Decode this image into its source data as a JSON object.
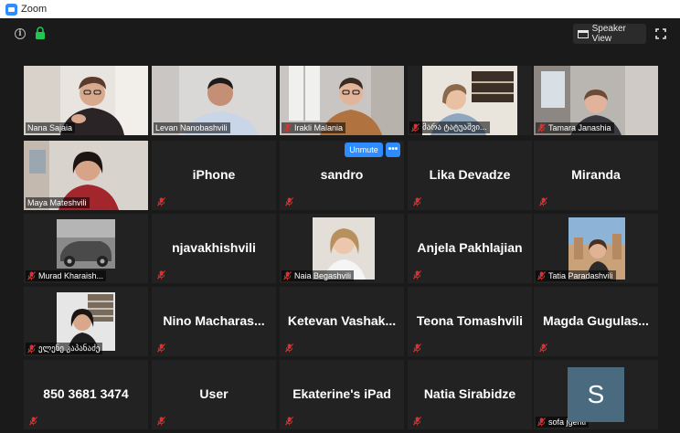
{
  "window": {
    "title": "Zoom"
  },
  "toolbar": {
    "speaker_view_label": "Speaker View"
  },
  "tile_actions": {
    "unmute_label": "Unmute",
    "more_label": "•••"
  },
  "colors": {
    "active_speaker_border": "#c6d94a",
    "accent": "#2d8cff",
    "muted_mic": "#e02f2f",
    "tile_bg": "#222222",
    "avatar_bg": "#4a6b7f"
  },
  "participants": [
    {
      "name": "Nana Sajaia",
      "video": true,
      "active_speaker": true
    },
    {
      "name": "Levan Nanobashvili",
      "video": true
    },
    {
      "name": "Irakli Malania",
      "video": true,
      "muted": true
    },
    {
      "name": "მარა ტატუაშვი...",
      "video": true,
      "muted": true
    },
    {
      "name": "Tamara Janashia",
      "video": true,
      "muted": true
    },
    {
      "name": "Maya Mateshvili",
      "video": true
    },
    {
      "name": "iPhone",
      "video": false,
      "muted": true
    },
    {
      "name": "sandro",
      "video": false,
      "muted": true,
      "hovered": true
    },
    {
      "name": "Lika Devadze",
      "video": false,
      "muted": true
    },
    {
      "name": "Miranda",
      "video": false,
      "muted": true
    },
    {
      "name": "Murad Kharaish...",
      "video": false,
      "profile_picture": true,
      "muted": true
    },
    {
      "name": "njavakhishvili",
      "video": false,
      "muted": true
    },
    {
      "name": "Naia Begashvili",
      "video": false,
      "profile_picture": true,
      "muted": true
    },
    {
      "name": "Anjela Pakhlajian",
      "video": false,
      "muted": true
    },
    {
      "name": "Tatia Paradashvili",
      "video": false,
      "profile_picture": true,
      "muted": true
    },
    {
      "name": "ელენე კაპანაძე",
      "video": false,
      "profile_picture": true,
      "muted": true
    },
    {
      "name": "Nino  Macharas...",
      "video": false,
      "muted": true
    },
    {
      "name": "Ketevan  Vashak...",
      "video": false,
      "muted": true
    },
    {
      "name": "Teona Tomashvili",
      "video": false,
      "muted": true
    },
    {
      "name": "Magda  Gugulas...",
      "video": false,
      "muted": true
    },
    {
      "name": "850 3681 3474",
      "video": false,
      "muted": true
    },
    {
      "name": "User",
      "video": false,
      "muted": true
    },
    {
      "name": "Ekaterine's iPad",
      "video": false,
      "muted": true
    },
    {
      "name": "Natia Sirabidze",
      "video": false,
      "muted": true
    },
    {
      "name": "sofa jgenti",
      "video": false,
      "avatar_letter": "S",
      "muted": true
    }
  ]
}
